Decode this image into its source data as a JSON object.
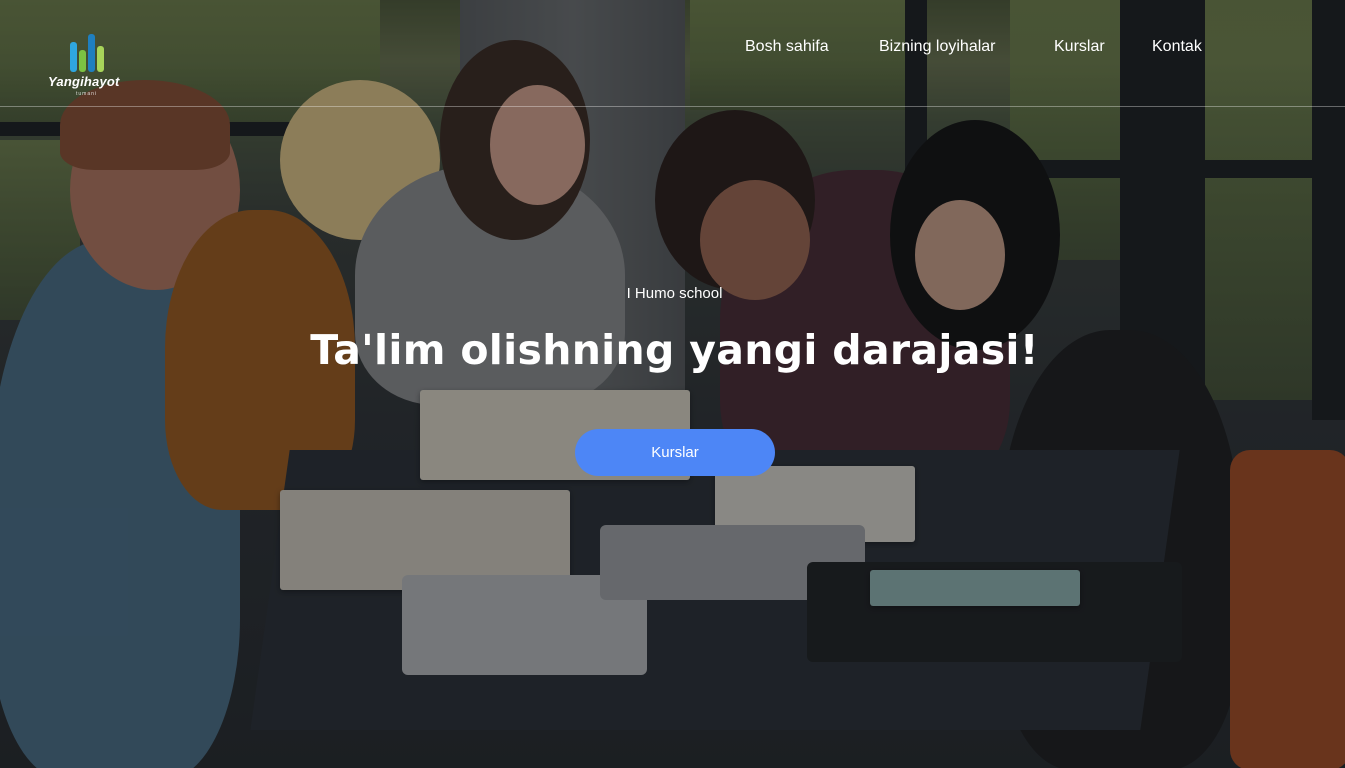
{
  "brand": {
    "name": "Yangihayot",
    "subtitle": "tumani",
    "colors": {
      "bar1": "#2fa6df",
      "bar2": "#7cc242",
      "bar3": "#1f7fbf",
      "bar4": "#a8d45a"
    }
  },
  "nav": {
    "items": [
      {
        "label": "Bosh sahifa"
      },
      {
        "label": "Bizning loyihalar"
      },
      {
        "label": "Kurslar"
      },
      {
        "label": "Kontak"
      }
    ]
  },
  "hero": {
    "kicker": "I Humo school",
    "title": "Ta'lim olishning yangi darajasi!",
    "cta_label": "Kurslar",
    "cta_color": "#4d86f6"
  }
}
